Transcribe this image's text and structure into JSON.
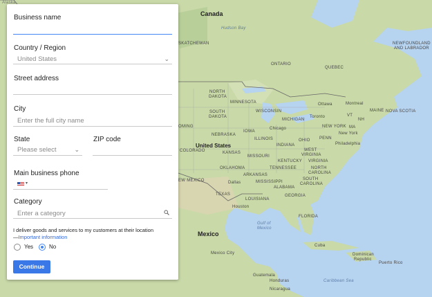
{
  "form": {
    "business_name_label": "Business name",
    "country_label": "Country / Region",
    "country_value": "United States",
    "street_label": "Street address",
    "city_label": "City",
    "city_placeholder": "Enter the full city name",
    "state_label": "State",
    "state_placeholder": "Please select",
    "zip_label": "ZIP code",
    "phone_label": "Main business phone",
    "category_label": "Category",
    "category_placeholder": "Enter a category",
    "delivery_question": "I deliver goods and services to my customers at their location",
    "important_link": "Important information",
    "yes_label": "Yes",
    "no_label": "No",
    "selected_option": "No",
    "continue_label": "Continue"
  },
  "map_labels": {
    "canada": "Canada",
    "hudson_bay": "Hudson Bay",
    "saskatchewan": "SKATCHEWAN",
    "ontario": "ONTARIO",
    "quebec": "QUEBEC",
    "newfoundland": "NEWFOUNDLAND",
    "labrador": "AND LABRADOR",
    "north_dakota_1": "NORTH",
    "north_dakota_2": "DAKOTA",
    "minnesota": "MINNESOTA",
    "south_dakota_1": "SOUTH",
    "south_dakota_2": "DAKOTA",
    "wisconsin": "WISCONSIN",
    "michigan": "MICHIGAN",
    "ottawa": "Ottawa",
    "montreal": "Montreal",
    "maine": "MAINE",
    "nova_scotia": "NOVA SCOTIA",
    "toronto": "Toronto",
    "vt": "VT",
    "nh": "NH",
    "new_york": "NEW YORK",
    "ma": "MA",
    "wyoming": "OMING",
    "nebraska": "NEBRASKA",
    "iowa": "IOWA",
    "chicago": "Chicago",
    "ohio": "OHIO",
    "penn": "PENN",
    "new_york_city": "New York",
    "united_states": "United States",
    "colorado": "COLORADO",
    "kansas": "KANSAS",
    "illinois": "ILLINOIS",
    "indiana": "INDIANA",
    "missouri": "MISSOURI",
    "west_virginia_1": "WEST",
    "west_virginia_2": "VIRGINIA",
    "philadelphia": "Philadelphia",
    "kentucky": "KENTUCKY",
    "virginia": "VIRGINIA",
    "oklahoma": "OKLAHOMA",
    "tennessee": "TENNESSEE",
    "north_carolina_1": "NORTH",
    "north_carolina_2": "CAROLINA",
    "new_mexico": "EW MEXICO",
    "arkansas": "ARKANSAS",
    "dallas": "Dallas",
    "mississippi": "MISSISSIPPI",
    "alabama": "ALABAMA",
    "south_carolina_1": "SOUTH",
    "south_carolina_2": "CAROLINA",
    "texas": "TEXAS",
    "louisiana": "LOUISIANA",
    "houston": "Houston",
    "georgia": "GEORGIA",
    "florida": "FLORIDA",
    "gulf_1": "Gulf of",
    "gulf_2": "Mexico",
    "mexico": "Mexico",
    "mexico_city": "Mexico City",
    "cuba": "Cuba",
    "dominican_1": "Dominican",
    "dominican_2": "Republic",
    "puerto_rico": "Puerto Rico",
    "guatemala": "Guatemala",
    "honduras": "Honduras",
    "nicaragua": "Nicaragua",
    "caribbean": "Caribbean Sea",
    "alaska_partial": "Alaska"
  },
  "colors": {
    "accent": "#3b78e7",
    "link": "#3367d6",
    "water": "#b6d3f0",
    "land": "#c9d9a8"
  }
}
